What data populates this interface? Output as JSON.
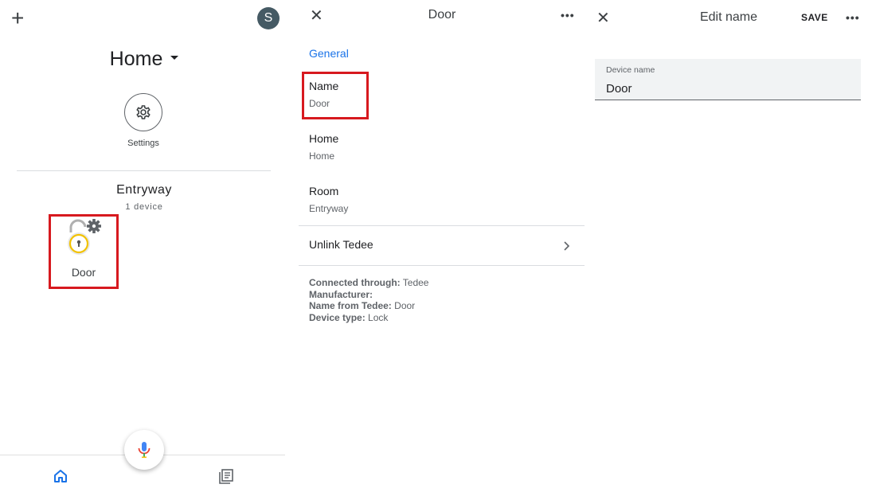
{
  "panel_home": {
    "add_label": "+",
    "avatar_letter": "S",
    "home_title": "Home",
    "settings_label": "Settings",
    "room": {
      "name": "Entryway",
      "count": "1 device"
    },
    "device": {
      "name": "Door",
      "icon": "lock-open-icon"
    },
    "nav": {
      "home_icon": "home-icon",
      "feed_icon": "feed-icon",
      "mic_icon": "mic-icon"
    }
  },
  "panel_device": {
    "close_label": "✕",
    "title": "Door",
    "more_label": "•••",
    "section": "General",
    "rows": [
      {
        "title": "Name",
        "sub": "Door"
      },
      {
        "title": "Home",
        "sub": "Home"
      },
      {
        "title": "Room",
        "sub": "Entryway"
      }
    ],
    "unlink_label": "Unlink Tedee",
    "info": [
      {
        "key": "Connected through:",
        "value": "Tedee"
      },
      {
        "key": "Manufacturer:",
        "value": ""
      },
      {
        "key": "Name from Tedee:",
        "value": "Door"
      },
      {
        "key": "Device type:",
        "value": "Lock"
      }
    ]
  },
  "panel_edit": {
    "close_label": "✕",
    "title": "Edit name",
    "save_label": "SAVE",
    "more_label": "•••",
    "field_label": "Device name",
    "field_value": "Door"
  },
  "colors": {
    "highlight": "#d7191f",
    "accent": "#1a73e8",
    "avatar": "#455a64"
  }
}
